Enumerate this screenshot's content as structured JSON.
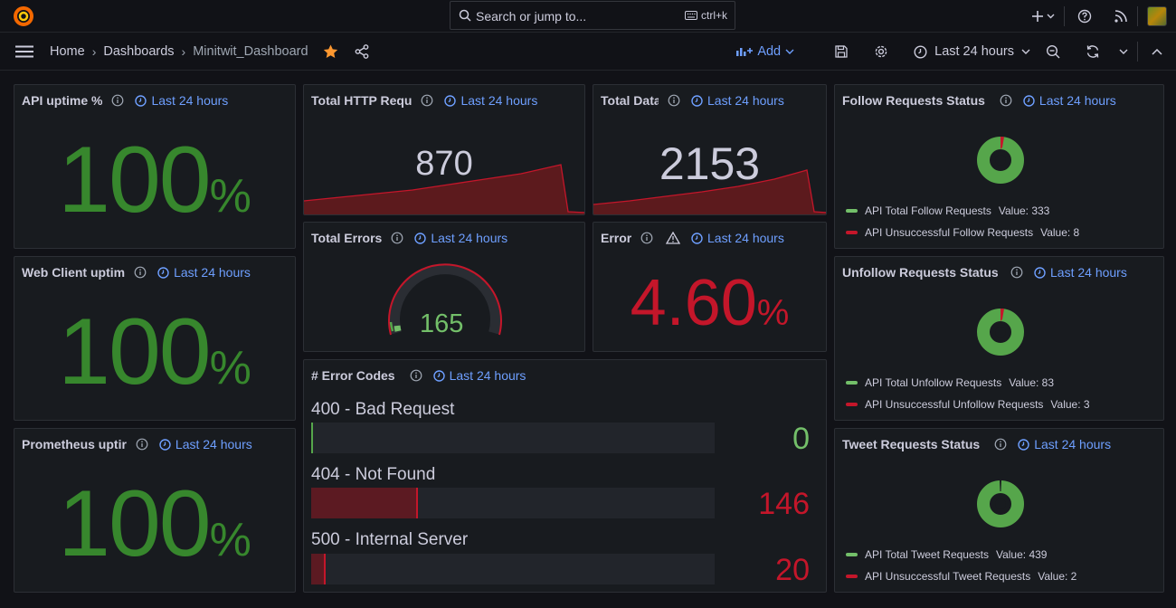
{
  "search": {
    "placeholder": "Search or jump to...",
    "shortcut": "ctrl+k"
  },
  "breadcrumb": {
    "home": "Home",
    "dashboards": "Dashboards",
    "current": "Minitwit_Dashboard"
  },
  "toolbar": {
    "add_label": "Add",
    "time_range": "Last 24 hours"
  },
  "colors": {
    "green": "#37872d",
    "red": "#c4162a",
    "blue": "#6e9fff",
    "orange": "#ff9830"
  },
  "panels": {
    "api_uptime": {
      "title": "API uptime %",
      "time": "Last 24 hours",
      "value": "100",
      "unit": "%"
    },
    "web_uptime": {
      "title": "Web Client uptim",
      "time": "Last 24 hours",
      "value": "100",
      "unit": "%"
    },
    "prom_uptime": {
      "title": "Prometheus uptir",
      "time": "Last 24 hours",
      "value": "100",
      "unit": "%"
    },
    "http_requests": {
      "title": "Total HTTP Requ",
      "time": "Last 24 hours",
      "value": "870"
    },
    "total_data": {
      "title": "Total Data",
      "time": "Last 24 hours",
      "value": "2153"
    },
    "total_errors": {
      "title": "Total Errors",
      "time": "Last 24 hours",
      "value": "165",
      "gauge_fraction": 0.05
    },
    "error_rate": {
      "title": "Error",
      "time": "Last 24 hours",
      "value": "4.60",
      "unit": "%"
    },
    "error_codes": {
      "title": "# Error Codes",
      "time": "Last 24 hours",
      "rows": [
        {
          "label": "400 - Bad Request",
          "value": "0",
          "fraction": 0.0,
          "color": "#56a64b"
        },
        {
          "label": "404 - Not Found",
          "value": "146",
          "fraction": 0.265,
          "color": "#c4162a"
        },
        {
          "label": "500 - Internal Server",
          "value": "20",
          "fraction": 0.036,
          "color": "#c4162a"
        }
      ]
    },
    "follow": {
      "title": "Follow Requests Status",
      "time": "Last 24 hours",
      "legend": [
        {
          "label": "API Total Follow Requests",
          "value_text": "Value: 333"
        },
        {
          "label": "API Unsuccessful Follow Requests",
          "value_text": "Value: 8"
        }
      ]
    },
    "unfollow": {
      "title": "Unfollow Requests Status",
      "time": "Last 24 hours",
      "legend": [
        {
          "label": "API Total Unfollow Requests",
          "value_text": "Value: 83"
        },
        {
          "label": "API Unsuccessful Unfollow Requests",
          "value_text": "Value: 3"
        }
      ]
    },
    "tweet": {
      "title": "Tweet Requests Status",
      "time": "Last 24 hours",
      "legend": [
        {
          "label": "API Total Tweet Requests",
          "value_text": "Value: 439"
        },
        {
          "label": "API Unsuccessful Tweet Requests",
          "value_text": "Value: 2"
        }
      ]
    }
  }
}
